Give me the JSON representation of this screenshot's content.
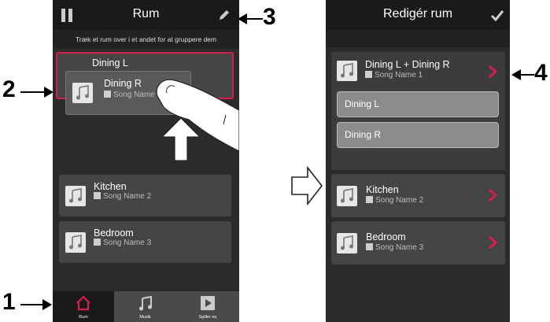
{
  "left_screen": {
    "title": "Rum",
    "hint": "Træk et rum over i et andet for at gruppere dem",
    "dragging_target": {
      "name": "Dining L"
    },
    "dragged_room": {
      "name": "Dining R",
      "song": "Song Name 1"
    },
    "rooms": [
      {
        "name": "Kitchen",
        "song": "Song Name 2"
      },
      {
        "name": "Bedroom",
        "song": "Song Name 3"
      }
    ],
    "tabs": [
      {
        "label": "Rum",
        "icon": "house-icon",
        "active": true
      },
      {
        "label": "Musik",
        "icon": "music-note-icon",
        "active": false
      },
      {
        "label": "Spiller nu",
        "icon": "play-icon",
        "active": false
      }
    ]
  },
  "right_screen": {
    "title": "Redigér rum",
    "group": {
      "name": "Dining L + Dining R",
      "song": "Song Name 1"
    },
    "group_members": [
      "Dining L",
      "Dining R"
    ],
    "rooms": [
      {
        "name": "Kitchen",
        "song": "Song Name 2"
      },
      {
        "name": "Bedroom",
        "song": "Song Name 3"
      }
    ]
  },
  "callouts": {
    "c1": "1",
    "c2": "2",
    "c3": "3",
    "c4": "4"
  },
  "colors": {
    "accent": "#d4204a",
    "background": "#2b2b2b",
    "header": "#1a1a1a"
  }
}
